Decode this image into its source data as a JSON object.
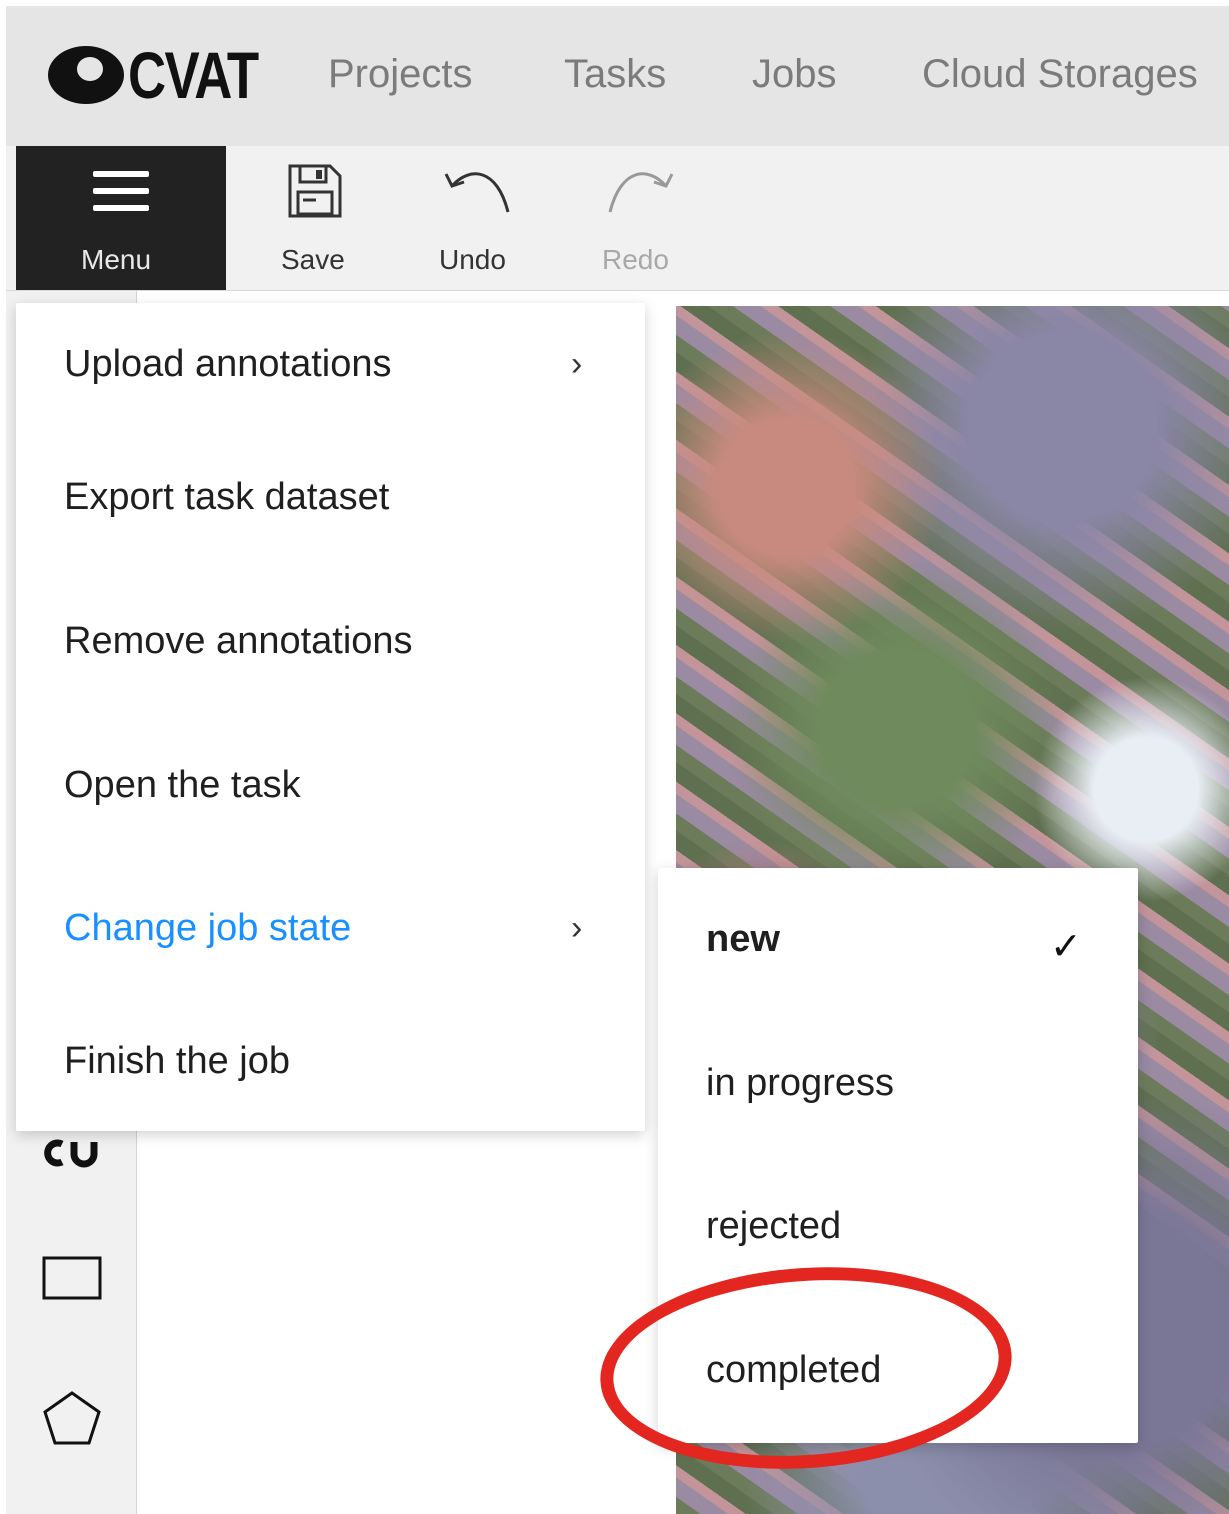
{
  "header": {
    "logo_text": "CVAT",
    "nav": [
      "Projects",
      "Tasks",
      "Jobs",
      "Cloud Storages"
    ]
  },
  "toolbar": {
    "menu_label": "Menu",
    "save_label": "Save",
    "undo_label": "Undo",
    "redo_label": "Redo"
  },
  "menu": {
    "items": [
      {
        "label": "Upload annotations",
        "has_submenu": true
      },
      {
        "label": "Export task dataset",
        "has_submenu": false
      },
      {
        "label": "Remove annotations",
        "has_submenu": false
      },
      {
        "label": "Open the task",
        "has_submenu": false
      },
      {
        "label": "Change job state",
        "has_submenu": true,
        "active": true
      },
      {
        "label": "Finish the job",
        "has_submenu": false
      }
    ],
    "chevron": "›"
  },
  "job_state_submenu": {
    "options": [
      "new",
      "in progress",
      "rejected",
      "completed"
    ],
    "selected": "new",
    "check_glyph": "✓"
  },
  "icons": {
    "sidebar": [
      "ai-tools-icon",
      "rectangle-icon",
      "polygon-icon"
    ],
    "toolbar": [
      "hamburger-icon",
      "save-icon",
      "undo-icon",
      "redo-icon"
    ]
  },
  "colors": {
    "active_menu_text": "#1890ff",
    "menu_button_bg": "#222222",
    "highlight_circle": "#e3261f"
  }
}
